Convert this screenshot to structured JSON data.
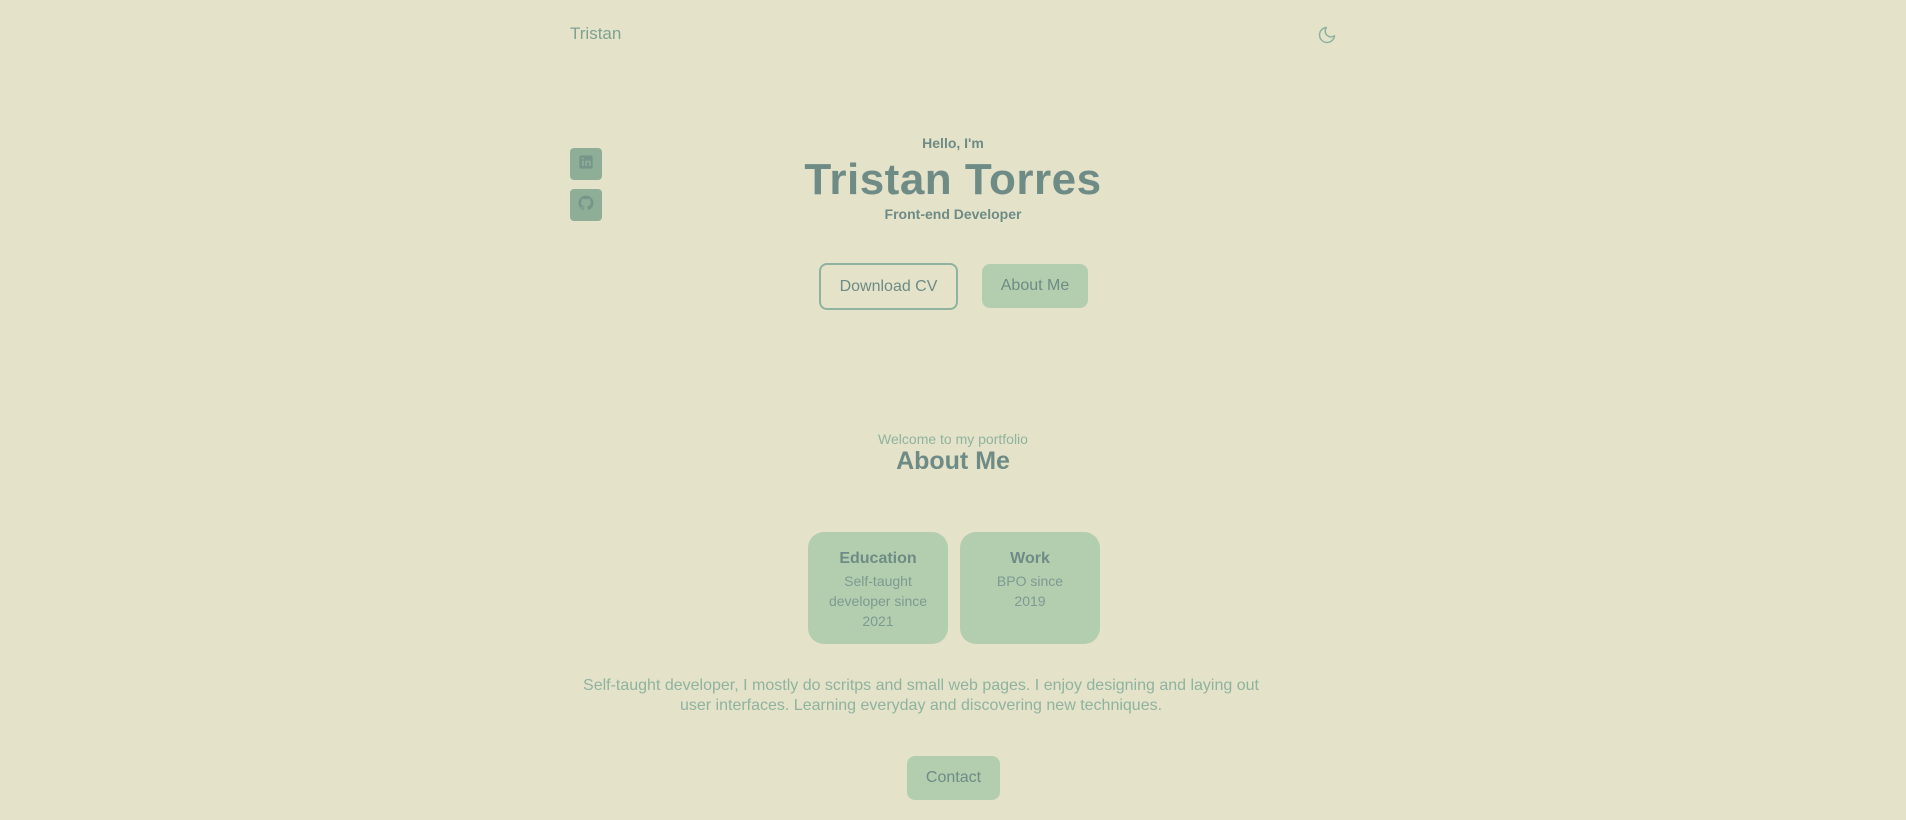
{
  "nav": {
    "brand": "Tristan",
    "theme_toggle_icon": "moon-icon"
  },
  "socials": [
    {
      "name": "LinkedIn",
      "icon": "linkedin-icon"
    },
    {
      "name": "GitHub",
      "icon": "github-icon"
    }
  ],
  "hero": {
    "greeting": "Hello, I'm",
    "name": "Tristan Torres",
    "role": "Front-end Developer",
    "download_cv_label": "Download CV",
    "about_me_label": "About Me"
  },
  "about": {
    "subtitle": "Welcome to my portfolio",
    "title": "About Me",
    "cards": [
      {
        "title": "Education",
        "text": "Self-taught developer since 2021"
      },
      {
        "title": "Work",
        "text": "BPO since 2019"
      }
    ],
    "description": "Self-taught developer, I mostly do scritps and small web pages. I enjoy designing and laying out user interfaces. Learning everyday and discovering new techniques.",
    "contact_label": "Contact"
  },
  "colors": {
    "background": "#e4e2c8",
    "accent": "#b3ceae",
    "text": "#6e8b86",
    "muted": "#8fb39f",
    "social_bg": "#8fae97"
  }
}
